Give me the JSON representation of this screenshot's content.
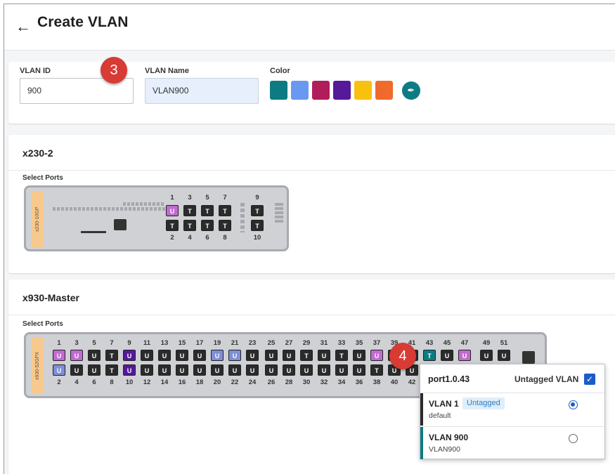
{
  "header": {
    "back_icon": "arrow-left-icon",
    "title": "Create VLAN"
  },
  "form": {
    "vlan_id_label": "VLAN ID",
    "vlan_id_value": "900",
    "vlan_name_label": "VLAN Name",
    "vlan_name_value": "VLAN900",
    "color_label": "Color",
    "colors": [
      "#0e7b82",
      "#6a98f0",
      "#b01d5b",
      "#55199a",
      "#f8c10e",
      "#f06a2b"
    ],
    "picker_icon": "eyedropper-icon"
  },
  "steps": {
    "step3": "3",
    "step4": "4"
  },
  "switches": [
    {
      "name": "x230-2",
      "select_label": "Select Ports",
      "model": "x230-10GP",
      "top_numbers": [
        "1",
        "3",
        "5",
        "7",
        "9"
      ],
      "bottom_numbers": [
        "2",
        "4",
        "6",
        "8",
        "10"
      ],
      "top_ports": [
        "U",
        "T",
        "T",
        "T",
        "T"
      ],
      "bottom_ports": [
        "T",
        "T",
        "T",
        "T",
        "T"
      ]
    },
    {
      "name": "x930-Master",
      "select_label": "Select Ports",
      "model": "x930-52GPX",
      "top_numbers": [
        "1",
        "3",
        "5",
        "7",
        "9",
        "11",
        "13",
        "15",
        "17",
        "19",
        "21",
        "23",
        "25",
        "27",
        "29",
        "31",
        "33",
        "35",
        "37",
        "39",
        "41",
        "43",
        "45",
        "47",
        "49",
        "51"
      ],
      "bottom_numbers": [
        "2",
        "4",
        "6",
        "8",
        "10",
        "12",
        "14",
        "16",
        "18",
        "20",
        "22",
        "24",
        "26",
        "28",
        "30",
        "32",
        "34",
        "36",
        "38",
        "40",
        "42"
      ],
      "top_ports": [
        "U",
        "U",
        "U",
        "T",
        "U",
        "U",
        "U",
        "U",
        "U",
        "U",
        "U",
        "U",
        "U",
        "U",
        "T",
        "U",
        "T",
        "U",
        "U",
        "U",
        "U",
        "T",
        "U",
        "U",
        "U",
        "U"
      ],
      "bottom_ports": [
        "U",
        "U",
        "U",
        "T",
        "U",
        "U",
        "U",
        "U",
        "U",
        "U",
        "U",
        "U",
        "U",
        "U",
        "U",
        "U",
        "U",
        "U",
        "T",
        "U",
        "U"
      ]
    }
  ],
  "popup": {
    "port": "port1.0.43",
    "untagged_label": "Untagged VLAN",
    "vlans": [
      {
        "name": "VLAN 1",
        "tag": "Untagged",
        "sub": "default",
        "selected": true,
        "accent": "#2b2b2b"
      },
      {
        "name": "VLAN 900",
        "tag": "",
        "sub": "VLAN900",
        "selected": false,
        "accent": "#0e7b82"
      }
    ]
  }
}
